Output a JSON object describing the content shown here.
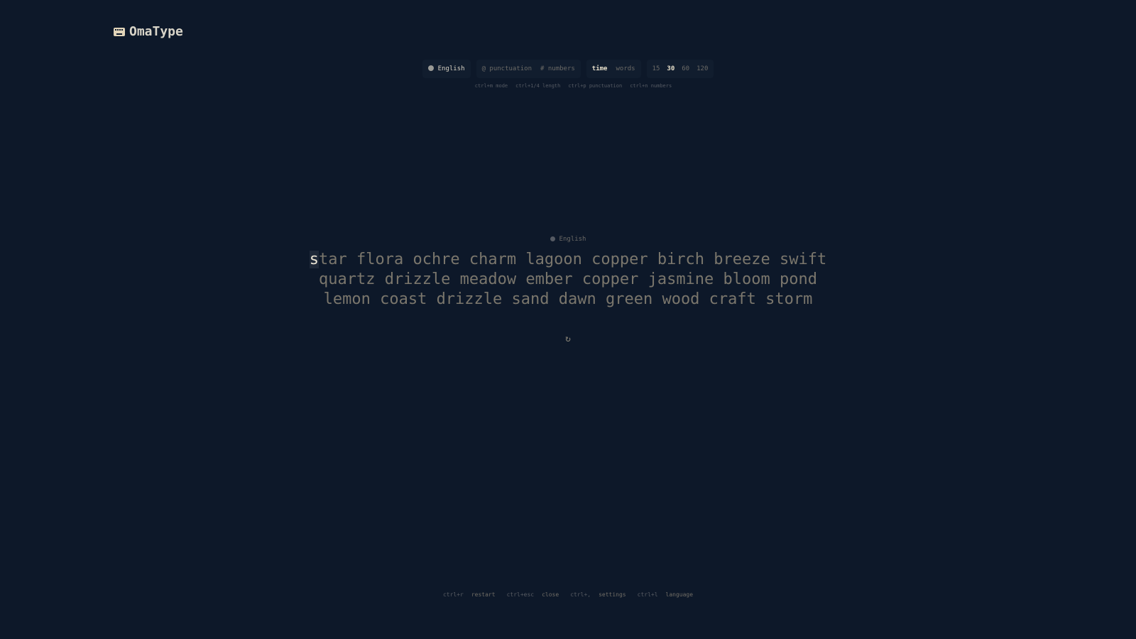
{
  "app": {
    "title": "OmaType",
    "logo_icon": "keyboard-icon"
  },
  "toolbar": {
    "language": {
      "icon": "globe-icon",
      "label": "English"
    },
    "options": [
      {
        "label": "@ punctuation",
        "active": false
      },
      {
        "label": "# numbers",
        "active": false
      }
    ],
    "modes": [
      {
        "label": "time",
        "active": true
      },
      {
        "label": "words",
        "active": false
      }
    ],
    "lengths": [
      {
        "label": "15",
        "active": false
      },
      {
        "label": "30",
        "active": true
      },
      {
        "label": "60",
        "active": false
      },
      {
        "label": "120",
        "active": false
      }
    ]
  },
  "hints": [
    "ctrl+m mode",
    "ctrl+1/4 length",
    "ctrl+p punctuation",
    "ctrl+n numbers"
  ],
  "test": {
    "language_label": "English",
    "caret_char": "s",
    "lines": [
      "tar flora ochre charm lagoon copper birch breeze swift",
      "quartz drizzle meadow ember copper jasmine bloom pond",
      "lemon coast drizzle sand dawn green wood craft storm"
    ],
    "restart_icon": "↻"
  },
  "footer": [
    {
      "key": "ctrl+r",
      "label": "restart"
    },
    {
      "key": "ctrl+esc",
      "label": "close"
    },
    {
      "key": "ctrl+,",
      "label": "settings"
    },
    {
      "key": "ctrl+l",
      "label": "language"
    }
  ],
  "colors": {
    "background": "#0d1829",
    "panel": "#111d2e",
    "text_dim": "#7a766c",
    "text_active": "#e7dfca"
  }
}
